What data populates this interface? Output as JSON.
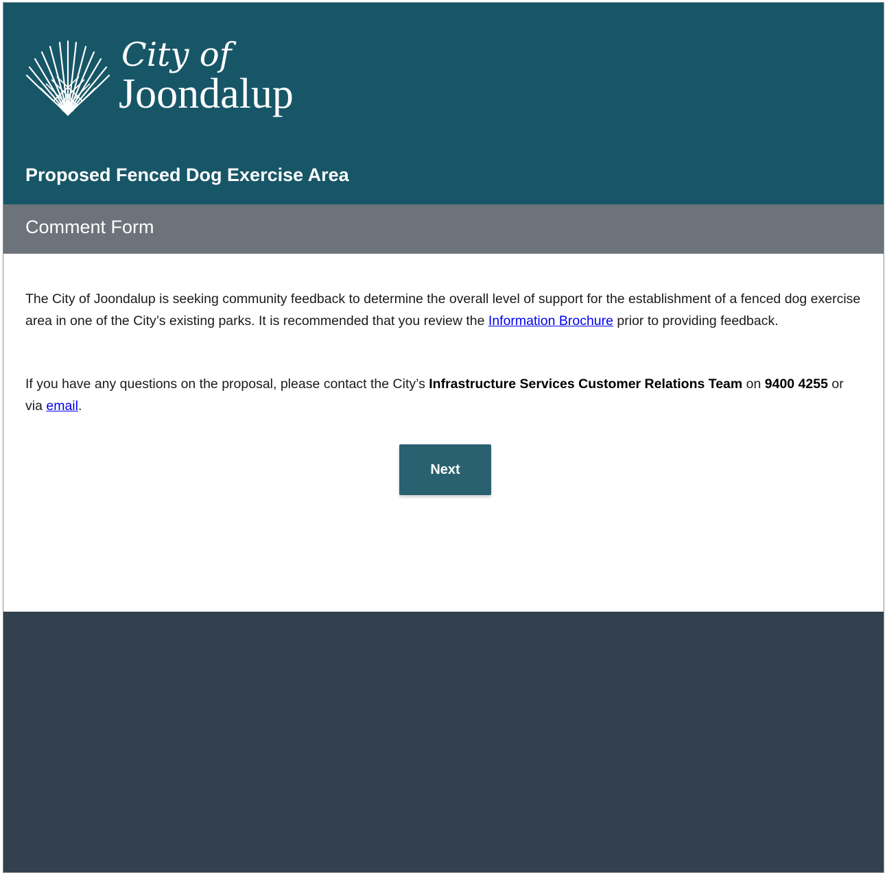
{
  "header": {
    "logo_line1": "City of",
    "logo_line2": "Joondalup",
    "survey_title": "Proposed Fenced Dog Exercise Area",
    "background_color": "#175667"
  },
  "section": {
    "title": "Comment Form",
    "background_color": "#6d737a"
  },
  "body": {
    "paragraph1": {
      "text_before_link": "The City of Joondalup is seeking community feedback to determine the overall level of support for the establishment of a fenced dog exercise area in one of the City’s existing parks. It is recommended that you review the ",
      "link_text": "Information Brochure",
      "text_after_link": " prior to providing feedback."
    },
    "paragraph2": {
      "text1": "If you have any questions on the proposal, please contact the City’s ",
      "team_name": "Infrastructure Services Customer Relations Team",
      "text2": " on ",
      "phone": "9400 4255",
      "text3": " or via ",
      "email_link": "email",
      "text4": "."
    }
  },
  "actions": {
    "next_label": "Next",
    "button_color": "#2a6170"
  },
  "footer": {
    "background_color": "#33414e"
  }
}
